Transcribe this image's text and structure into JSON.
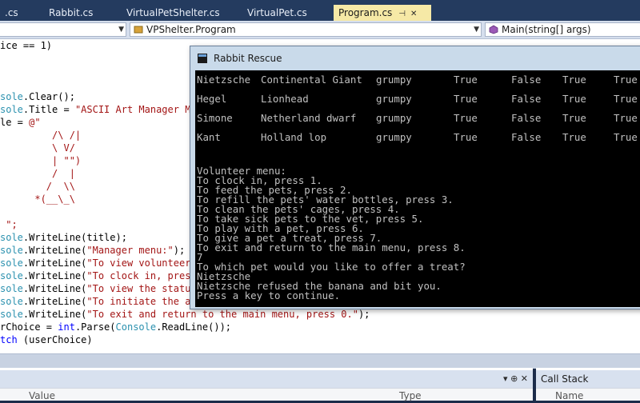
{
  "tabs": [
    {
      "label": ".cs"
    },
    {
      "label": "Rabbit.cs"
    },
    {
      "label": "VirtualPetShelter.cs"
    },
    {
      "label": "VirtualPet.cs"
    },
    {
      "label": "Program.cs",
      "active": true
    }
  ],
  "nav": {
    "namespace_box": "",
    "class_box": "VPShelter.Program",
    "member_box": "Main(string[] args)"
  },
  "editor": {
    "lines": [
      "ice == 1)",
      "",
      "",
      "",
      "sole.Clear();",
      "sole.Title = \"ASCII Art Manager Me",
      "le = @\"",
      "         /\\ /|",
      "         \\ V/",
      "         | \"\")",
      "         /  |",
      "        /  \\\\",
      "      *(__\\_\\",
      "",
      " \";",
      "sole.WriteLine(title);",
      "sole.WriteLine(\"Manager menu:\");",
      "sole.WriteLine(\"To view volunteer",
      "sole.WriteLine(\"To clock in, press",
      "sole.WriteLine(\"To view the status",
      "sole.WriteLine(\"To initiate the ad",
      "sole.WriteLine(\"To exit and return to the main menu, press 0.\");",
      "rChoice = int.Parse(Console.ReadLine());",
      "tch (userChoice)"
    ]
  },
  "console": {
    "title": "Rabbit Rescue",
    "table": [
      [
        "Nietzsche",
        "Continental Giant",
        "grumpy",
        "True",
        "False",
        "True",
        "True"
      ],
      [
        "Hegel",
        "Lionhead",
        "grumpy",
        "True",
        "False",
        "True",
        "True"
      ],
      [
        "Simone",
        "Netherland dwarf",
        "grumpy",
        "True",
        "False",
        "True",
        "True"
      ],
      [
        "Kant",
        "Holland lop",
        "grumpy",
        "True",
        "False",
        "True",
        "True"
      ]
    ],
    "menu_lines": [
      "Volunteer menu:",
      "To clock in, press 1.",
      "To feed the pets, press 2.",
      "To refill the pets' water bottles, press 3.",
      "To clean the pets' cages, press 4.",
      "To take sick pets to the vet, press 5.",
      "To play with a pet, press 6.",
      "To give a pet a treat, press 7.",
      "To exit and return to the main menu, press 8.",
      "7",
      "To which pet would you like to offer a treat?",
      "Nietzsche",
      "Nietzsche refused the banana and bit you.",
      "Press a key to continue."
    ]
  },
  "bottom": {
    "left_col_value": "Value",
    "left_col_type": "Type",
    "left_icons": "▾ ⊕ ✕",
    "right_title": "Call Stack",
    "right_col_name": "Name"
  },
  "colors": {
    "chrome_dark": "#243b5f",
    "active_tab": "#f6e9a6",
    "keyword": "#0000ff",
    "type": "#2b91af",
    "string": "#a31515"
  }
}
